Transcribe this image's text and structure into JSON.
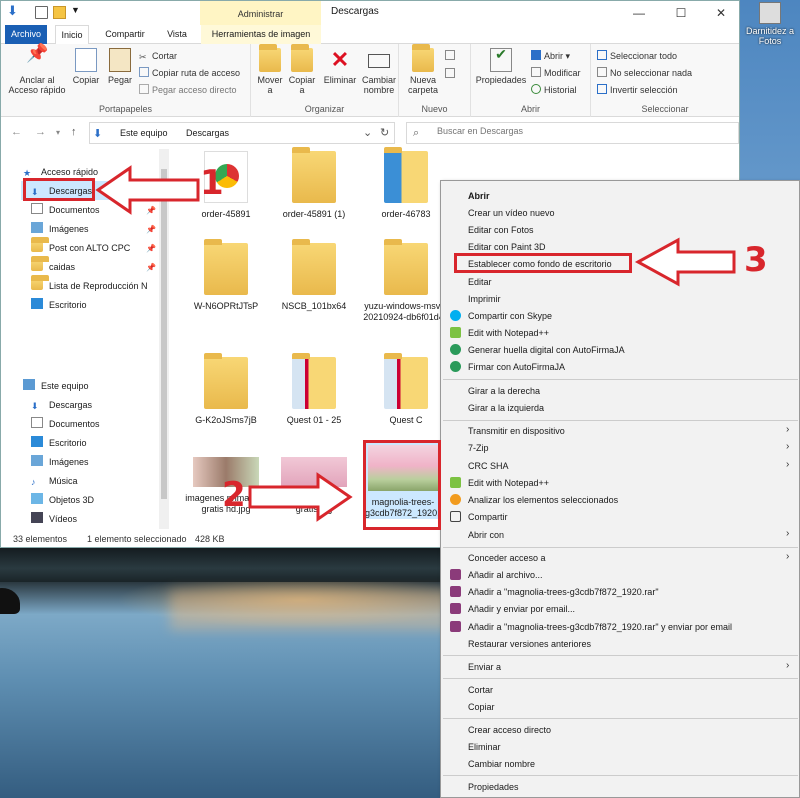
{
  "window": {
    "title": "Descargas",
    "manage_tab": "Administrar",
    "controls": {
      "minimize": "—",
      "maximize": "☐",
      "close": "✕"
    }
  },
  "desktop": {
    "icon_label": "Darnitidez a Fotos"
  },
  "ribbon_tabs": [
    "Archivo",
    "Inicio",
    "Compartir",
    "Vista",
    "Herramientas de imagen"
  ],
  "ribbon": {
    "portapapeles": {
      "label": "Portapapeles",
      "anclar": "Anclar al Acceso rápido",
      "copiar": "Copiar",
      "pegar": "Pegar",
      "cortar": "Cortar",
      "copiar_ruta": "Copiar ruta de acceso",
      "pegar_acceso": "Pegar acceso directo"
    },
    "organizar": {
      "label": "Organizar",
      "mover": "Mover a",
      "copiar": "Copiar a",
      "eliminar": "Eliminar",
      "cambiar": "Cambiar nombre"
    },
    "nuevo": {
      "label": "Nuevo",
      "carpeta": "Nueva carpeta"
    },
    "abrir": {
      "label": "Abrir",
      "propiedades": "Propiedades",
      "abrir": "Abrir",
      "modificar": "Modificar",
      "historial": "Historial"
    },
    "seleccionar": {
      "label": "Seleccionar",
      "todo": "Seleccionar todo",
      "ninguno": "No seleccionar nada",
      "invertir": "Invertir selección"
    }
  },
  "address": {
    "path": [
      "Este equipo",
      "Descargas"
    ],
    "search_placeholder": "Buscar en Descargas"
  },
  "navpane": {
    "quick_access": "Acceso rápido",
    "quick_items": [
      "Descargas",
      "Documentos",
      "Imágenes",
      "Post con ALTO CPC",
      "caidas",
      "Lista de Reproducción N",
      "Escritorio"
    ],
    "this_pc": "Este equipo",
    "pc_items": [
      "Descargas",
      "Documentos",
      "Escritorio",
      "Imágenes",
      "Música",
      "Objetos 3D",
      "Vídeos"
    ]
  },
  "files": [
    {
      "name": "order-45891"
    },
    {
      "name": "order-45891 (1)"
    },
    {
      "name": "order-46783"
    },
    {
      "name": "W-N6OPRtJTsP"
    },
    {
      "name": "NSCB_101bx64"
    },
    {
      "name": "yuzu-windows-msvc-20210924-db6f01d42"
    },
    {
      "name": "G-K2oJSms7jB"
    },
    {
      "name": "Quest 01 - 25"
    },
    {
      "name": "Quest C"
    },
    {
      "name": "imagenes primavera gratis hd.jpg"
    },
    {
      "name": "foto primavera gratis.jpg"
    },
    {
      "name": "magnolia-trees-g3cdb7f872_1920.jpg"
    }
  ],
  "status": {
    "count": "33 elementos",
    "selected": "1 elemento seleccionado",
    "size": "428 KB"
  },
  "context_menu": [
    "Abrir",
    "Crear un vídeo nuevo",
    "Editar con Fotos",
    "Editar con Paint 3D",
    "Establecer como fondo de escritorio",
    "Editar",
    "Imprimir",
    "Compartir con Skype",
    "Edit with Notepad++",
    "Generar huella digital con AutoFirmaJA",
    "Firmar con AutoFirmaJA",
    "Girar a la derecha",
    "Girar a la izquierda",
    "Transmitir en dispositivo",
    "7-Zip",
    "CRC SHA",
    "Edit with Notepad++",
    "Analizar los elementos seleccionados",
    "Compartir",
    "Abrir con",
    "Conceder acceso a",
    "Añadir al archivo...",
    "Añadir a \"magnolia-trees-g3cdb7f872_1920.rar\"",
    "Añadir y enviar por email...",
    "Añadir a \"magnolia-trees-g3cdb7f872_1920.rar\" y enviar por email",
    "Restaurar versiones anteriores",
    "Enviar a",
    "Cortar",
    "Copiar",
    "Crear acceso directo",
    "Eliminar",
    "Cambiar nombre",
    "Propiedades"
  ],
  "annotations": [
    "1",
    "2",
    "3"
  ],
  "colors": {
    "accent": "#1a5fb4",
    "annotation_red": "#d8262c",
    "selection": "#cce8ff",
    "folder": "#f8d775"
  }
}
